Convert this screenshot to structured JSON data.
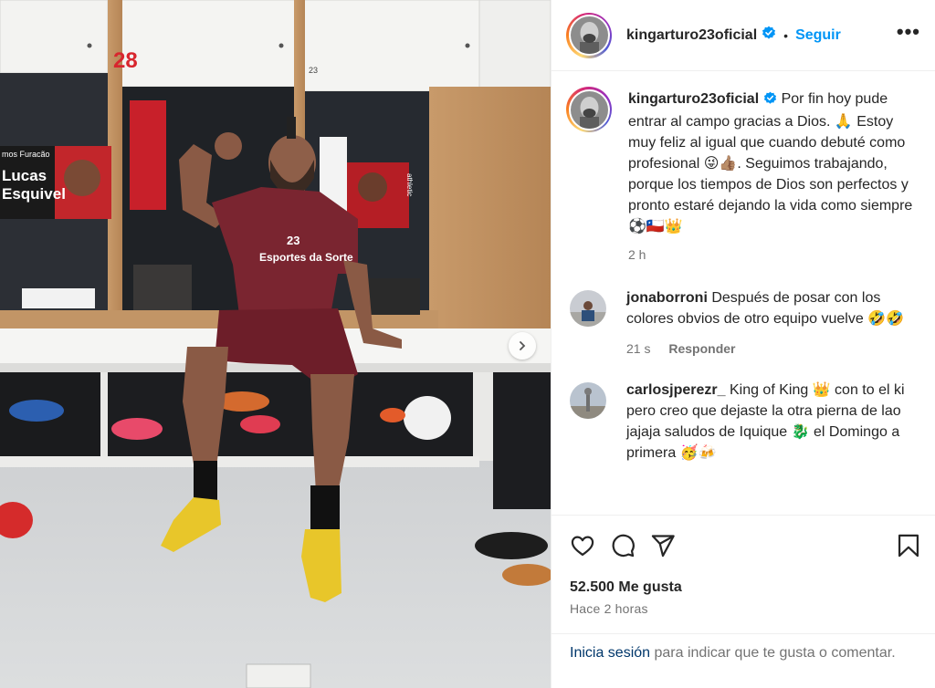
{
  "post": {
    "photo_jersey_text": "Esportes da Sorte",
    "photo_jersey_number": "23",
    "locker_number_1": "28",
    "locker_number_2": "23",
    "banner_line1": "mos Furacão",
    "banner_name_first": "Lucas",
    "banner_name_last": "Esquivel",
    "banner_right_text": "athletic"
  },
  "header": {
    "username": "kingarturo23oficial",
    "separator": "•",
    "follow_label": "Seguir",
    "more_label": "•••"
  },
  "caption": {
    "username": "kingarturo23oficial",
    "text": " Por fin hoy pude entrar al campo gracias a Dios. 🙏 Estoy muy feliz al igual que cuando debuté como profesional 😜👍🏽. Seguimos trabajando, porque los tiempos de Dios son perfectos y pronto estaré dejando la vida como siempre ⚽🇨🇱👑",
    "time": "2 h"
  },
  "comments": [
    {
      "username": "jonaborroni",
      "text": " Después de posar con los colores obvios de otro equipo vuelve 🤣🤣",
      "time": "21 s",
      "reply_label": "Responder"
    },
    {
      "username": "carlosjperezr_",
      "text": " King of King 👑 con to el ki pero creo que dejaste la otra pierna de lao jajaja saludos de Iquique 🐉 el Domingo a primera 🥳🍻",
      "time": "",
      "reply_label": ""
    }
  ],
  "actions": {
    "likes": "52.500 Me gusta",
    "timestamp": "Hace 2 horas"
  },
  "login": {
    "link": "Inicia sesión",
    "rest": " para indicar que te gusta o comentar."
  },
  "colors": {
    "follow": "#0095f6",
    "verified": "#0095f6",
    "jersey": "#7a2530",
    "boots": "#e8c62a",
    "link": "#00376b"
  }
}
